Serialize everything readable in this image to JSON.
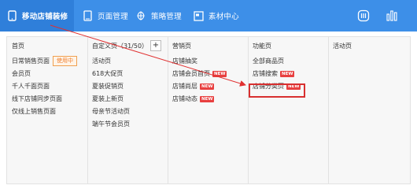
{
  "nav": {
    "items": [
      {
        "label": "移动店铺装修",
        "icon": "phone-icon",
        "active": true
      },
      {
        "label": "页面管理",
        "icon": "page-icon",
        "active": false
      },
      {
        "label": "策略管理",
        "icon": "strategy-icon",
        "active": false
      },
      {
        "label": "素材中心",
        "icon": "folder-icon",
        "active": false
      }
    ],
    "right_icons": [
      "qrcode-icon",
      "stats-icon"
    ]
  },
  "columns": [
    {
      "header": "首页",
      "items": [
        {
          "label": "日常销售页面",
          "in_use": "使用中"
        },
        {
          "label": "会员页"
        },
        {
          "label": "千人千面页面"
        },
        {
          "label": "线下店铺同步页面"
        },
        {
          "label": "仅线上销售页面"
        }
      ]
    },
    {
      "header": "自定义页（31/50）",
      "add_label": "+",
      "items": [
        {
          "label": "活动页"
        },
        {
          "label": "618大促页"
        },
        {
          "label": "夏装促销页"
        },
        {
          "label": "夏装上新页"
        },
        {
          "label": "母亲节活动页"
        },
        {
          "label": "端午节会员页"
        }
      ]
    },
    {
      "header": "营销页",
      "items": [
        {
          "label": "店铺抽奖"
        },
        {
          "label": "店铺会员首页",
          "badge": "NEW"
        },
        {
          "label": "店铺尚层",
          "badge": "NEW"
        },
        {
          "label": "店铺动态",
          "badge": "NEW"
        }
      ]
    },
    {
      "header": "功能页",
      "items": [
        {
          "label": "全部商品页"
        },
        {
          "label": "店铺搜索",
          "badge": "NEW"
        },
        {
          "label": "店铺分类页",
          "badge": "NEW"
        }
      ]
    },
    {
      "header": "活动页",
      "items": []
    }
  ],
  "colors": {
    "topbar": "#3d8fe8",
    "active_tab": "#2f7fda",
    "annotation": "#e03030",
    "badge": "#e84040"
  }
}
